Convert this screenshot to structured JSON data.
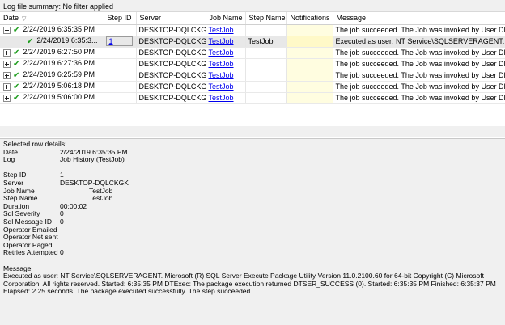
{
  "summary": "Log file summary: No filter applied",
  "grid": {
    "columns": [
      "Date",
      "Step ID",
      "Server",
      "Job Name",
      "Step Name",
      "Notifications",
      "Message"
    ],
    "rows": [
      {
        "expander": "minus",
        "date": "2/24/2019 6:35:35 PM",
        "step_id": "",
        "server": "DESKTOP-DQLCKGK",
        "job": "TestJob",
        "step_name": "",
        "message": "The job succeeded.  The Job was invoked by User DESKTOP-DQLCKGK"
      },
      {
        "expander": "none",
        "date": "2/24/2019 6:35:3...",
        "step_id": "1",
        "server": "DESKTOP-DQLCKGK",
        "job": "TestJob",
        "step_name": "TestJob",
        "message": "Executed as user: NT Service\\SQLSERVERAGENT. Microsoft (R) SQL Server Execute Package Utility"
      },
      {
        "expander": "plus",
        "date": "2/24/2019 6:27:50 PM",
        "step_id": "",
        "server": "DESKTOP-DQLCKGK",
        "job": "TestJob",
        "step_name": "",
        "message": "The job succeeded.  The Job was invoked by User DESKTOP-DQLCKGK"
      },
      {
        "expander": "plus",
        "date": "2/24/2019 6:27:36 PM",
        "step_id": "",
        "server": "DESKTOP-DQLCKGK",
        "job": "TestJob",
        "step_name": "",
        "message": "The job succeeded.  The Job was invoked by User DESKTOP-DQLCKGK"
      },
      {
        "expander": "plus",
        "date": "2/24/2019 6:25:59 PM",
        "step_id": "",
        "server": "DESKTOP-DQLCKGK",
        "job": "TestJob",
        "step_name": "",
        "message": "The job succeeded.  The Job was invoked by User DESKTOP-DQLCKGK"
      },
      {
        "expander": "plus",
        "date": "2/24/2019 5:06:18 PM",
        "step_id": "",
        "server": "DESKTOP-DQLCKGK",
        "job": "TestJob",
        "step_name": "",
        "message": "The job succeeded.  The Job was invoked by User DESKTOP-DQLCKGK"
      },
      {
        "expander": "plus",
        "date": "2/24/2019 5:06:00 PM",
        "step_id": "",
        "server": "DESKTOP-DQLCKGK",
        "job": "TestJob",
        "step_name": "",
        "message": "The job succeeded.  The Job was invoked by User DESKTOP-DQLCKGK"
      }
    ]
  },
  "details": {
    "header": "Selected row details:",
    "date_label": "Date",
    "date_value": "2/24/2019 6:35:35 PM",
    "log_label": "Log",
    "log_value": "Job History (TestJob)",
    "step_id_label": "Step ID",
    "step_id_value": "1",
    "server_label": "Server",
    "server_value": "DESKTOP-DQLCKGK",
    "job_name_label": "Job Name",
    "job_name_value": "TestJob",
    "step_name_label": "Step Name",
    "step_name_value": "TestJob",
    "duration_label": "Duration",
    "duration_value": "00:00:02",
    "sql_severity_label": "Sql Severity",
    "sql_severity_value": "0",
    "sql_message_id_label": "Sql Message ID",
    "sql_message_id_value": "0",
    "operator_emailed_label": "Operator Emailed",
    "operator_net_sent_label": "Operator Net sent",
    "operator_paged_label": "Operator Paged",
    "retries_label": "Retries Attempted",
    "retries_value": "0",
    "message_label": "Message",
    "message_text": "Executed as user: NT Service\\SQLSERVERAGENT. Microsoft (R) SQL Server Execute Package Utility  Version 11.0.2100.60 for 64-bit  Copyright (C) Microsoft Corporation. All rights reserved.    Started:  6:35:35 PM  DTExec: The package execution returned DTSER_SUCCESS (0).  Started:  6:35:35 PM  Finished: 6:35:37 PM  Elapsed:  2.25 seconds.  The package executed successfully.  The step succeeded."
  },
  "colors": {
    "success_check": "#1f9e1f",
    "link": "#0000ee",
    "notification_cell": "#fffde0"
  },
  "icons": {
    "expand": "plus-box-icon",
    "collapse": "minus-box-icon",
    "status": "check-icon",
    "filter": "filter-icon"
  }
}
